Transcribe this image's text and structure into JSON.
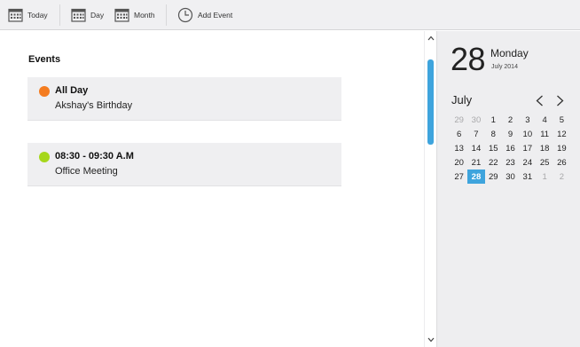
{
  "toolbar": {
    "today_label": "Today",
    "day_label": "Day",
    "month_label": "Month",
    "add_event_label": "Add Event"
  },
  "main": {
    "heading": "Events",
    "events": [
      {
        "time": "All Day",
        "title": "Akshay's Birthday",
        "color": "#f47c20"
      },
      {
        "time": "08:30 - 09:30 A.M",
        "title": "Office Meeting",
        "color": "#a6d71c"
      }
    ]
  },
  "side": {
    "day_number": "28",
    "weekday": "Monday",
    "month_year": "July 2014",
    "month_name": "July",
    "accent": "#3ea4dd",
    "days": [
      {
        "d": "29",
        "muted": true
      },
      {
        "d": "30",
        "muted": true
      },
      {
        "d": "1"
      },
      {
        "d": "2"
      },
      {
        "d": "3"
      },
      {
        "d": "4"
      },
      {
        "d": "5"
      },
      {
        "d": "6"
      },
      {
        "d": "7"
      },
      {
        "d": "8"
      },
      {
        "d": "9"
      },
      {
        "d": "10"
      },
      {
        "d": "11"
      },
      {
        "d": "12"
      },
      {
        "d": "13"
      },
      {
        "d": "14"
      },
      {
        "d": "15"
      },
      {
        "d": "16"
      },
      {
        "d": "17"
      },
      {
        "d": "18"
      },
      {
        "d": "19"
      },
      {
        "d": "20"
      },
      {
        "d": "21"
      },
      {
        "d": "22"
      },
      {
        "d": "23"
      },
      {
        "d": "24"
      },
      {
        "d": "25"
      },
      {
        "d": "26"
      },
      {
        "d": "27"
      },
      {
        "d": "28",
        "selected": true
      },
      {
        "d": "29"
      },
      {
        "d": "30"
      },
      {
        "d": "31"
      },
      {
        "d": "1",
        "muted": true
      },
      {
        "d": "2",
        "muted": true
      }
    ]
  }
}
